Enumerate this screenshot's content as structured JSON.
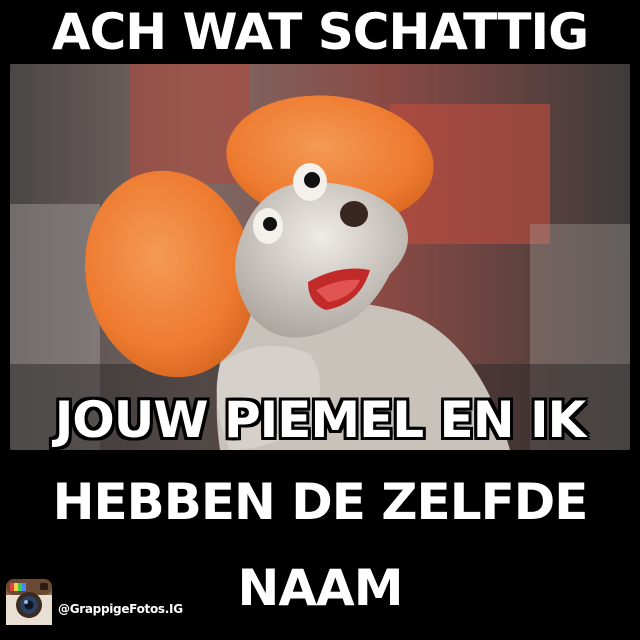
{
  "caption": {
    "top": "ACH WAT SCHATTIG",
    "bottom_line_1": "JOUW PIEMEL EN IK",
    "bottom_line_2": "HEBBEN DE ZELFDE",
    "bottom_line_3": "NAAM"
  },
  "watermark": {
    "icon": "instagram-icon",
    "handle": "@GrappigeFotos.IG"
  },
  "colors": {
    "background": "#000000",
    "text": "#ffffff",
    "ears": "#f07a2c",
    "puppet": "#d8d2cc"
  }
}
